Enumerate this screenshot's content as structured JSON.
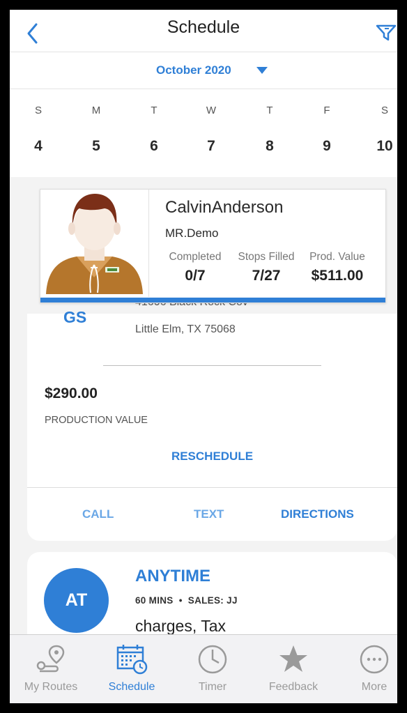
{
  "header": {
    "title": "Schedule"
  },
  "calendar": {
    "month_label": "October 2020",
    "days": [
      {
        "dow": "S",
        "num": "4"
      },
      {
        "dow": "M",
        "num": "5"
      },
      {
        "dow": "T",
        "num": "6"
      },
      {
        "dow": "W",
        "num": "7"
      },
      {
        "dow": "T",
        "num": "8"
      },
      {
        "dow": "F",
        "num": "9"
      },
      {
        "dow": "S",
        "num": "10"
      }
    ]
  },
  "profile": {
    "name": "CalvinAnderson",
    "company": "MR.Demo",
    "stats": [
      {
        "label": "Completed",
        "value": "0/7"
      },
      {
        "label": "Stops Filled",
        "value": "7/27"
      },
      {
        "label": "Prod. Value",
        "value": "$511.00"
      }
    ]
  },
  "appointment1": {
    "initials": "GS",
    "address_line1_partial": "41606 Black Rock Cov",
    "address_line2": "Little Elm, TX 75068",
    "production_value": "$290.00",
    "production_label": "PRODUCTION VALUE",
    "reschedule_label": "RESCHEDULE",
    "call_label": "CALL",
    "text_label": "TEXT",
    "directions_label": "DIRECTIONS"
  },
  "appointment2": {
    "initials": "AT",
    "window": "ANYTIME",
    "duration": "60 MINS",
    "bullet": "•",
    "sales": "SALES: JJ",
    "description": "charges, Tax"
  },
  "tabbar": {
    "items": [
      {
        "label": "My Routes",
        "icon": "route-icon"
      },
      {
        "label": "Schedule",
        "icon": "calendar-icon",
        "active": true
      },
      {
        "label": "Timer",
        "icon": "clock-icon"
      },
      {
        "label": "Feedback",
        "icon": "star-icon"
      },
      {
        "label": "More",
        "icon": "more-icon"
      }
    ]
  },
  "colors": {
    "accent": "#2f7fd6",
    "inactive": "#9a9a9a",
    "light_accent": "#6aa7e6"
  }
}
